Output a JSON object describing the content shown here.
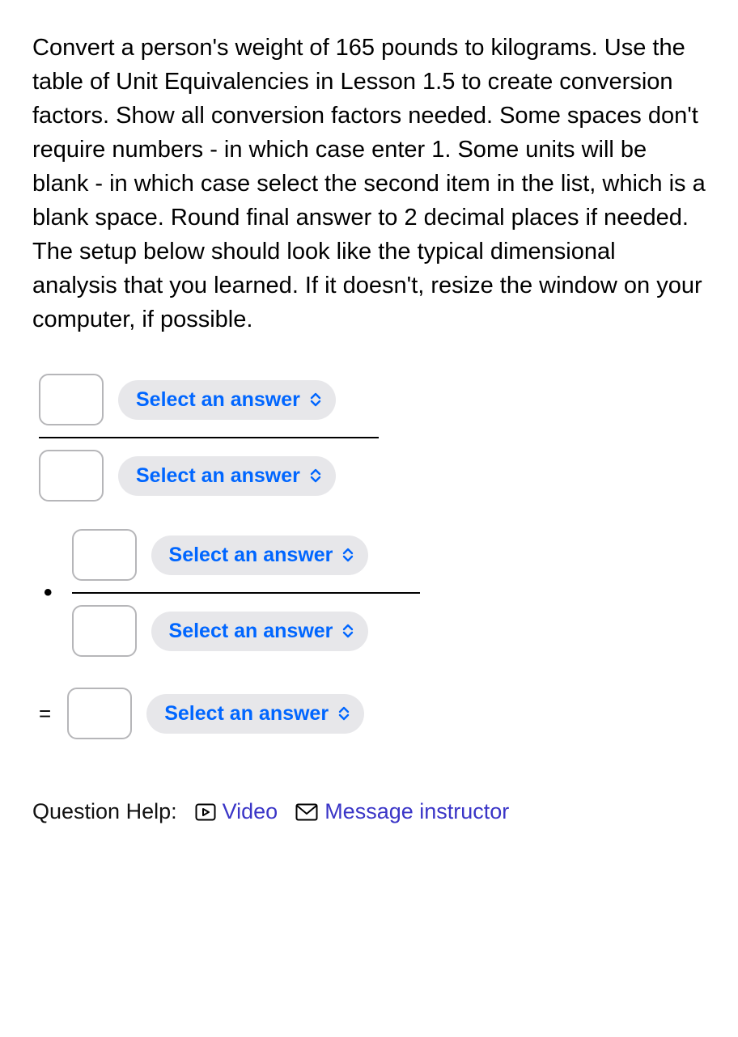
{
  "question": {
    "text": "Convert a person's weight of 165 pounds to kilograms. Use the table of Unit Equivalencies in Lesson 1.5 to create conversion factors. Show all conversion factors needed. Some spaces don't require numbers - in which case enter 1. Some units will be blank - in which case select the second item in the list, which is a blank space. Round final answer to 2 decimal places if needed. The setup below should look like the typical dimensional analysis that you learned. If it doesn't, resize the window on your computer, if possible."
  },
  "inputs": {
    "frac1_num_value": "",
    "frac1_num_unit": "Select an answer",
    "frac1_den_value": "",
    "frac1_den_unit": "Select an answer",
    "frac2_num_value": "",
    "frac2_num_unit": "Select an answer",
    "frac2_den_value": "",
    "frac2_den_unit": "Select an answer",
    "result_value": "",
    "result_unit": "Select an answer"
  },
  "symbols": {
    "dot": "•",
    "equals": "="
  },
  "help": {
    "label": "Question Help:",
    "video": "Video",
    "message": "Message instructor"
  }
}
